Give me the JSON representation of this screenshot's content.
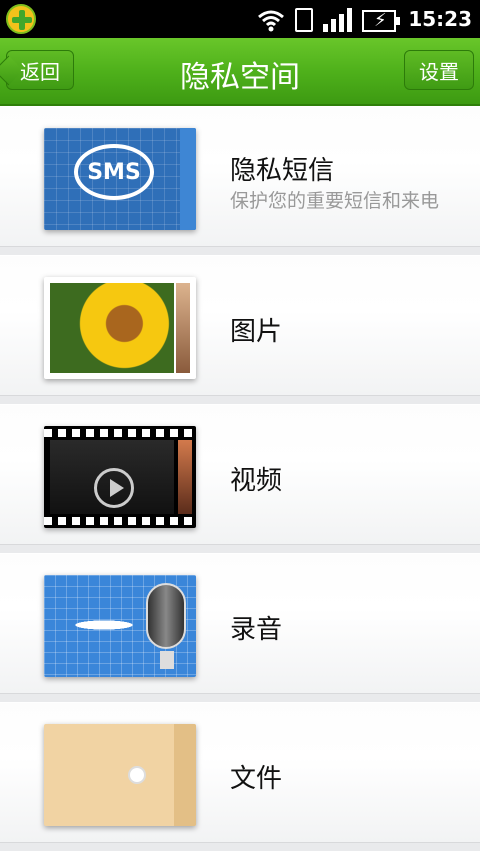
{
  "status_bar": {
    "time": "15:23"
  },
  "header": {
    "back_label": "返回",
    "title": "隐私空间",
    "settings_label": "设置"
  },
  "items": [
    {
      "title": "隐私短信",
      "subtitle": "保护您的重要短信和来电",
      "icon": "sms-icon"
    },
    {
      "title": "图片",
      "subtitle": "",
      "icon": "picture-icon"
    },
    {
      "title": "视频",
      "subtitle": "",
      "icon": "video-icon"
    },
    {
      "title": "录音",
      "subtitle": "",
      "icon": "recording-icon"
    },
    {
      "title": "文件",
      "subtitle": "",
      "icon": "file-icon"
    }
  ],
  "colors": {
    "brand_green": "#4fb11b",
    "subtitle_gray": "#999999"
  }
}
